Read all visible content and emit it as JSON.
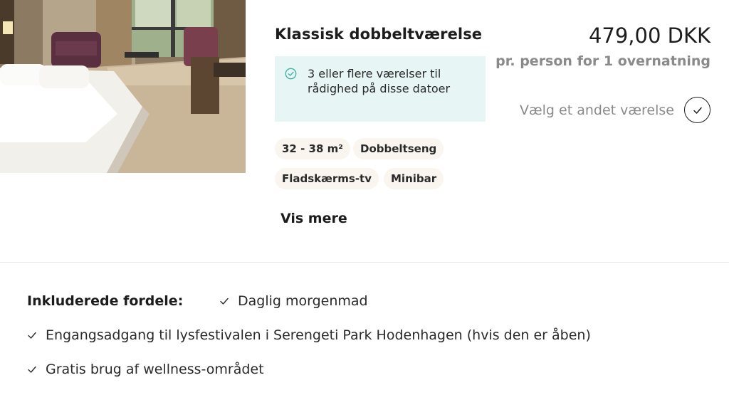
{
  "room": {
    "title": "Klassisk dobbeltværelse",
    "photo_icon": "room-photo",
    "availability": "3 eller flere værelser til rådighed på disse datoer",
    "tags": [
      "32 - 38 m²",
      "Dobbeltseng",
      "Fladskærms-tv",
      "Minibar"
    ],
    "more_label": "Vis mere"
  },
  "pricing": {
    "price": "479,00 DKK",
    "note": "pr. person for 1 overnatning",
    "select_label": "Vælg et andet værelse"
  },
  "benefits": {
    "heading": "Inkluderede fordele:",
    "items": [
      "Daglig morgenmad",
      "Engangsadgang til lysfestivalen i Serengeti Park Hodenhagen (hvis den er åben)",
      "Gratis brug af wellness-området"
    ]
  },
  "colors": {
    "availability_bg": "#e7f6f4",
    "availability_icon": "#3fb3a4",
    "tag_bg": "#faf5ef",
    "muted_text": "#8a8a8a"
  }
}
